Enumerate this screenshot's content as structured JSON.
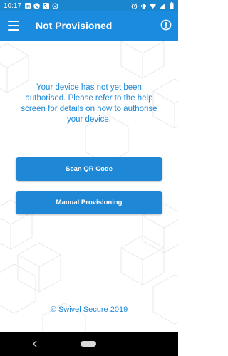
{
  "status_bar": {
    "time": "10:17",
    "battery": "battery-icon",
    "wifi": "wifi-icon",
    "signal": "signal-icon"
  },
  "app_bar": {
    "title": "Not Provisioned",
    "menu_icon": "hamburger-menu-icon",
    "info_icon": "info-icon"
  },
  "main": {
    "message": "Your device has not yet been authorised. Please refer to the help screen for details on how to authorise your device.",
    "scan_button": "Scan QR Code",
    "manual_button": "Manual Provisioning"
  },
  "footer": {
    "copyright": "© Swivel Secure 2019"
  },
  "colors": {
    "status_bar": "#1a86cf",
    "app_bar": "#1b8be0",
    "accent": "#1e88d6",
    "nav_bar": "#000000"
  }
}
